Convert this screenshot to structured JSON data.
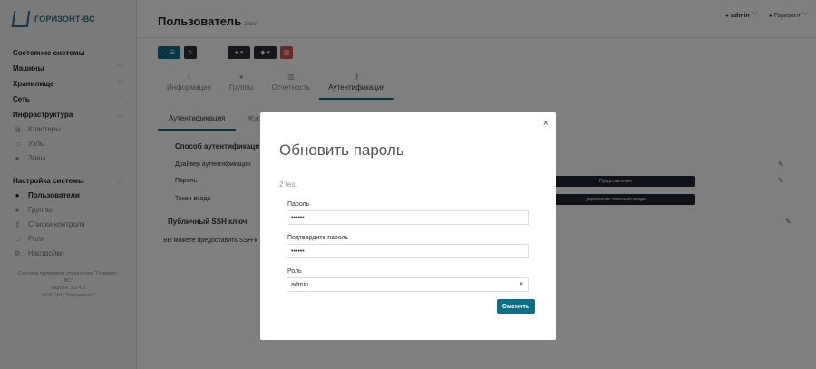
{
  "app": {
    "logo_text": "ГОРИЗОНТ-ВС"
  },
  "header": {
    "title": "Пользователь",
    "subtitle": "2 test",
    "user": "admin",
    "tenant": "Горизонт"
  },
  "sidebar": {
    "system_state": "Состояние системы",
    "machines": "Машины",
    "storage": "Хранилище",
    "network": "Сеть",
    "infrastructure": "Инфраструктура",
    "clusters": "Кластеры",
    "nodes": "Узлы",
    "zones": "Зоны",
    "settings_section": "Настройка системы",
    "users": "Пользователи",
    "groups": "Группы",
    "acl": "Списки контроля",
    "roles": "Роли",
    "settings": "Настройки",
    "footer_line1": "Система группового управления \"Горизонт-",
    "footer_line2": "ВС\"",
    "footer_line3": "версия: 1.0.4.2",
    "footer_line4": "ООО \"НЦ \"Баррикады\""
  },
  "tabs": {
    "info": "Информация",
    "groups": "Группы",
    "accounting": "Отчетность",
    "auth": "Аутентификация"
  },
  "subtabs": {
    "auth": "Аутентификация",
    "journal": "Жур"
  },
  "content": {
    "auth_method": "Способ аутентификаци",
    "driver": "Драйвер аутентификации",
    "password": "Пароль",
    "token": "Токен входа",
    "ssh_key": "Публичный SSH ключ",
    "ssh_text": "Вы можете предоставить SSH-к",
    "btn_represent": "Представление",
    "btn_tokens": "управление токенами входа"
  },
  "modal": {
    "title": "Обновить пароль",
    "subtitle": "2 test",
    "password_label": "Пароль",
    "password_value": "••••••",
    "confirm_label": "Подтвердите пароль",
    "confirm_value": "••••••",
    "role_label": "Роль",
    "role_value": "admin",
    "submit_label": "Сменить",
    "close_glyph": "×"
  },
  "colors": {
    "accent": "#0e6e86",
    "danger": "#d9534f",
    "dark": "#2b2f36"
  }
}
